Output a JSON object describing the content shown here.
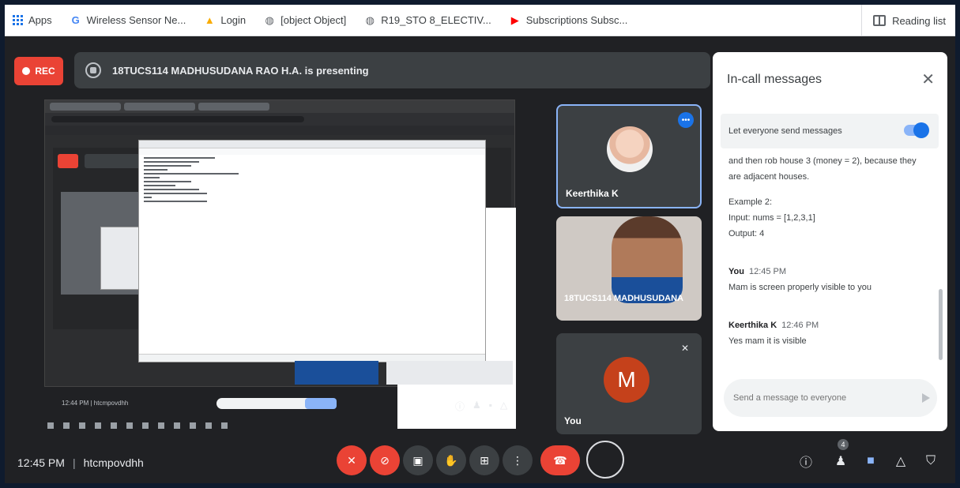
{
  "bookmarks": {
    "apps": "Apps",
    "wsn": "Wireless Sensor Ne...",
    "login": "Login",
    "object": "[object Object]",
    "r19": "R19_STO 8_ELECTIV...",
    "subs": "Subscriptions Subsc...",
    "reading_list": "Reading list"
  },
  "meet": {
    "rec_label": "REC",
    "presenting": "18TUCS114 MADHUSUDANA RAO H.A. is presenting",
    "tiles": [
      {
        "name": "Keerthika K"
      },
      {
        "name": "18TUCS114 MADHUSUDANA"
      },
      {
        "name": "You",
        "initial": "M"
      }
    ],
    "clock": "12:45 PM",
    "meeting_code": "htcmpovdhh",
    "people_count": "4",
    "accent": "#1a73e8",
    "danger": "#ea4335"
  },
  "shared_screen": {
    "mini_clock": "12:44 PM | htcmpovdhh"
  },
  "chat": {
    "title": "In-call messages",
    "toggle_label": "Let everyone send messages",
    "messages": [
      {
        "text1": "and then rob house 3 (money = 2), because they",
        "text2": "are adjacent houses."
      },
      {
        "line1": "Example 2:",
        "line2": "Input: nums = [1,2,3,1]",
        "line3": "Output: 4"
      },
      {
        "who": "You",
        "time": "12:45 PM",
        "text": "Mam is screen properly visible to you"
      },
      {
        "who": "Keerthika K",
        "time": "12:46 PM",
        "text": "Yes mam it is visible"
      }
    ],
    "input_placeholder": "Send a message to everyone"
  }
}
